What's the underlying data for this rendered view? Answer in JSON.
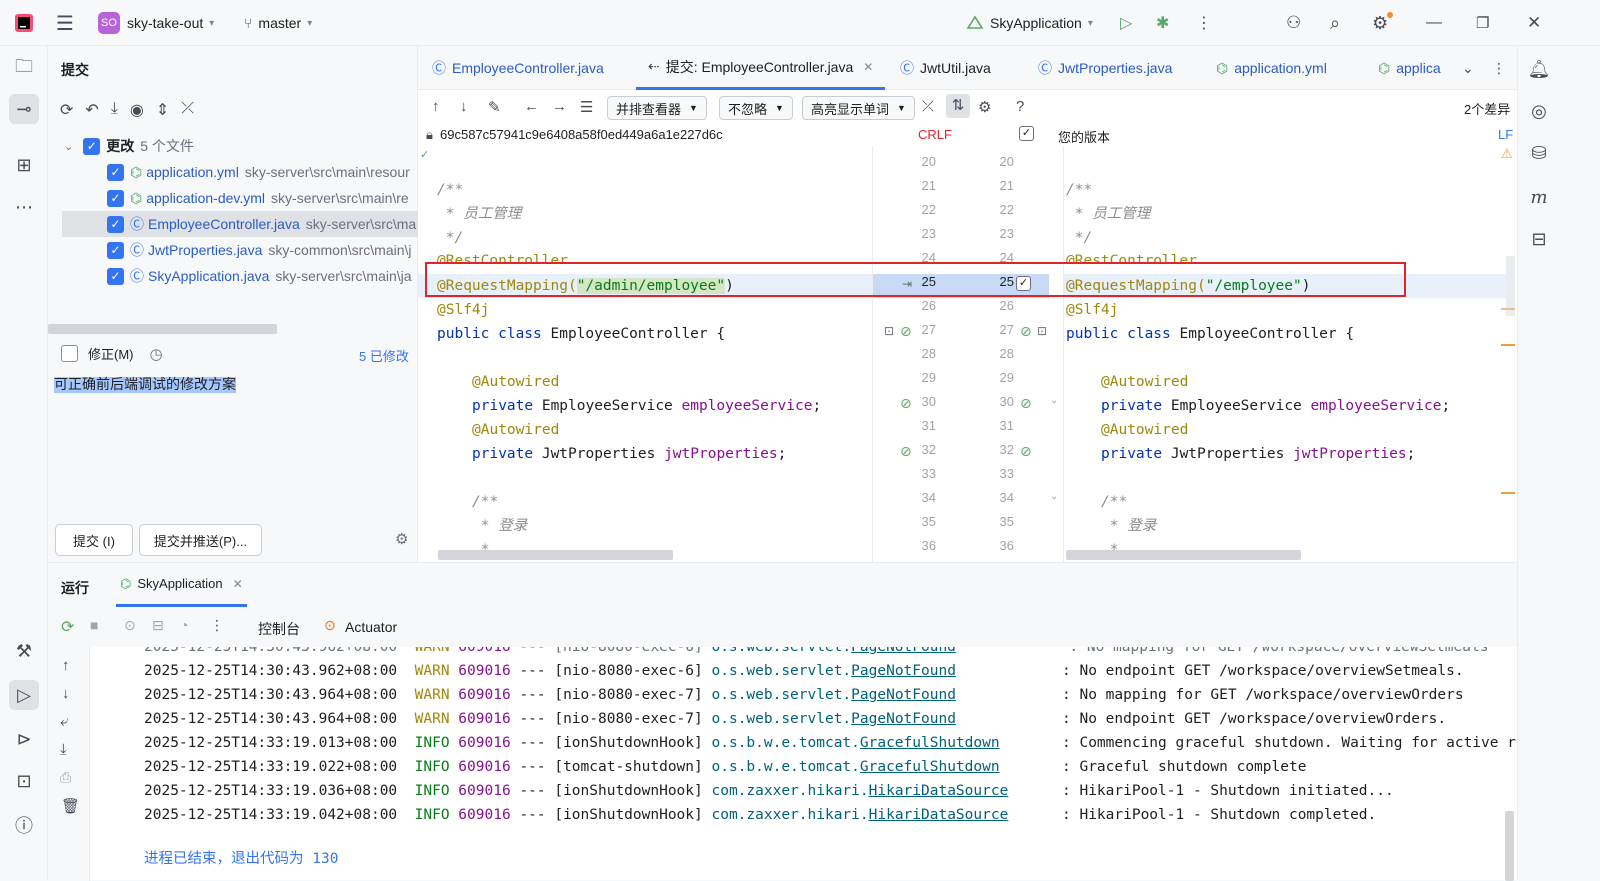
{
  "titlebar": {
    "project_badge": "SO",
    "project_name": "sky-take-out",
    "branch": "master",
    "run_config": "SkyApplication"
  },
  "commit_panel": {
    "title": "提交",
    "changes_label": "更改",
    "changes_count": "5 个文件",
    "files": [
      {
        "name": "application.yml",
        "path": "sky-server\\src\\main\\resour"
      },
      {
        "name": "application-dev.yml",
        "path": "sky-server\\src\\main\\re"
      },
      {
        "name": "EmployeeController.java",
        "path": "sky-server\\src\\ma"
      },
      {
        "name": "JwtProperties.java",
        "path": "sky-common\\src\\main\\j"
      },
      {
        "name": "SkyApplication.java",
        "path": "sky-server\\src\\main\\ja"
      }
    ],
    "amend_label": "修正(M)",
    "modified_count": "5 已修改",
    "commit_message": "可正确前后端调试的修改方案",
    "commit_button": "提交 (I)",
    "commit_push_button": "提交并推送(P)..."
  },
  "editor_tabs": [
    {
      "label": "EmployeeController.java"
    },
    {
      "label": "提交: EmployeeController.java"
    },
    {
      "label": "JwtUtil.java"
    },
    {
      "label": "JwtProperties.java"
    },
    {
      "label": "application.yml"
    },
    {
      "label": "applica"
    }
  ],
  "diff_toolbar": {
    "viewer": "并排查看器",
    "ignore": "不忽略",
    "highlight": "高亮显示单词",
    "diff_count": "2个差异"
  },
  "diff_header": {
    "left_hash": "69c587c57941c9e6408a58f0ed449a6a1e227d6c",
    "left_eol": "CRLF",
    "right_label": "您的版本",
    "right_eol": "LF"
  },
  "diff_lines": {
    "left_numbers": [
      "20",
      "21",
      "22",
      "23",
      "24",
      "25",
      "26",
      "27",
      "28",
      "29",
      "30",
      "31",
      "32",
      "33",
      "34",
      "35",
      "36"
    ],
    "right_numbers": [
      "20",
      "21",
      "22",
      "23",
      "24",
      "25",
      "26",
      "27",
      "28",
      "29",
      "30",
      "31",
      "32",
      "33",
      "34",
      "35",
      "36"
    ],
    "doc_open": "/**",
    "doc_text": " * 员工管理",
    "doc_close": " */",
    "rest_controller": "@RestController",
    "mapping_prefix": "@RequestMapping(",
    "mapping_left": "\"/admin/employee\"",
    "mapping_right": "\"/employee\"",
    "mapping_suffix": ")",
    "slf4j": "@Slf4j",
    "class_kw": "public class",
    "class_name": " EmployeeController {",
    "autowired": "@Autowired",
    "private_kw": "private",
    "emp_service_type": " EmployeeService ",
    "emp_service_field": "employeeService",
    "jwt_type": " JwtProperties ",
    "jwt_field": "jwtProperties",
    "semi": ";",
    "login_doc": " * 登录",
    "star": " *"
  },
  "run_panel": {
    "title": "运行",
    "tab": "SkyApplication",
    "console_tab": "控制台",
    "actuator_tab": "Actuator",
    "logs": [
      {
        "time": "2025-12-25T14:30:43.962+08:00",
        "level": "WARN",
        "pid": "609016",
        "sep": " --- ",
        "thread": "[nio-8080-exec-6]",
        "pkg": "o.s.web.servlet.",
        "cls": "PageNotFound",
        "msg": ": No endpoint GET /workspace/overviewSetmeals."
      },
      {
        "time": "2025-12-25T14:30:43.964+08:00",
        "level": "WARN",
        "pid": "609016",
        "sep": " --- ",
        "thread": "[nio-8080-exec-7]",
        "pkg": "o.s.web.servlet.",
        "cls": "PageNotFound",
        "msg": ": No mapping for GET /workspace/overviewOrders"
      },
      {
        "time": "2025-12-25T14:30:43.964+08:00",
        "level": "WARN",
        "pid": "609016",
        "sep": " --- ",
        "thread": "[nio-8080-exec-7]",
        "pkg": "o.s.web.servlet.",
        "cls": "PageNotFound",
        "msg": ": No endpoint GET /workspace/overviewOrders."
      },
      {
        "time": "2025-12-25T14:33:19.013+08:00",
        "level": "INFO",
        "pid": "609016",
        "sep": " --- ",
        "thread": "[ionShutdownHook]",
        "pkg": "o.s.b.w.e.tomcat.",
        "cls": "GracefulShutdown",
        "msg": ": Commencing graceful shutdown. Waiting for active request"
      },
      {
        "time": "2025-12-25T14:33:19.022+08:00",
        "level": "INFO",
        "pid": "609016",
        "sep": " --- ",
        "thread": "[tomcat-shutdown]",
        "pkg": "o.s.b.w.e.tomcat.",
        "cls": "GracefulShutdown",
        "msg": ": Graceful shutdown complete"
      },
      {
        "time": "2025-12-25T14:33:19.036+08:00",
        "level": "INFO",
        "pid": "609016",
        "sep": " --- ",
        "thread": "[ionShutdownHook]",
        "pkg": "com.zaxxer.hikari.",
        "cls": "HikariDataSource",
        "msg": ": HikariPool-1 - Shutdown initiated..."
      },
      {
        "time": "2025-12-25T14:33:19.042+08:00",
        "level": "INFO",
        "pid": "609016",
        "sep": " --- ",
        "thread": "[ionShutdownHook]",
        "pkg": "com.zaxxer.hikari.",
        "cls": "HikariDataSource",
        "msg": ": HikariPool-1 - Shutdown completed."
      }
    ],
    "exit_line": "进程已结束，退出代码为 130"
  },
  "colors": {
    "accent": "#3574f0",
    "diff_highlight_box": "#e0242a"
  }
}
